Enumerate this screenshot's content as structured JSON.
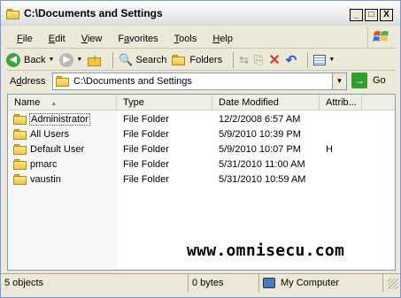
{
  "window": {
    "title": "C:\\Documents and Settings",
    "minimize_label": "_",
    "maximize_label": "□",
    "close_label": "X"
  },
  "menu": {
    "items": [
      {
        "underline": "F",
        "rest": "ile"
      },
      {
        "underline": "E",
        "rest": "dit"
      },
      {
        "underline": "V",
        "rest": "iew"
      },
      {
        "pre": "F",
        "underline": "a",
        "rest": "vorites"
      },
      {
        "underline": "T",
        "rest": "ools"
      },
      {
        "underline": "H",
        "rest": "elp"
      }
    ]
  },
  "toolbar": {
    "back_label": "Back",
    "search_label": "Search",
    "folders_label": "Folders"
  },
  "address": {
    "label": "Address",
    "label_underline": "d",
    "value": "C:\\Documents and Settings",
    "go_label": "Go"
  },
  "columns": {
    "name": "Name",
    "type": "Type",
    "date": "Date Modified",
    "attr": "Attrib..."
  },
  "rows": [
    {
      "name": "Administrator",
      "type": "File Folder",
      "date": "12/2/2008 6:57 AM",
      "attr": ""
    },
    {
      "name": "All Users",
      "type": "File Folder",
      "date": "5/9/2010 10:39 PM",
      "attr": ""
    },
    {
      "name": "Default User",
      "type": "File Folder",
      "date": "5/9/2010 10:07 PM",
      "attr": "H"
    },
    {
      "name": "pmarc",
      "type": "File Folder",
      "date": "5/31/2010 11:00 AM",
      "attr": ""
    },
    {
      "name": "vaustin",
      "type": "File Folder",
      "date": "5/31/2010 10:59 AM",
      "attr": ""
    }
  ],
  "watermark": "www.omnisecu.com",
  "status": {
    "objects": "5 objects",
    "size": "0 bytes",
    "location": "My Computer"
  },
  "colors": {
    "accent": "#3ca63c",
    "folder": "#f5c542"
  }
}
